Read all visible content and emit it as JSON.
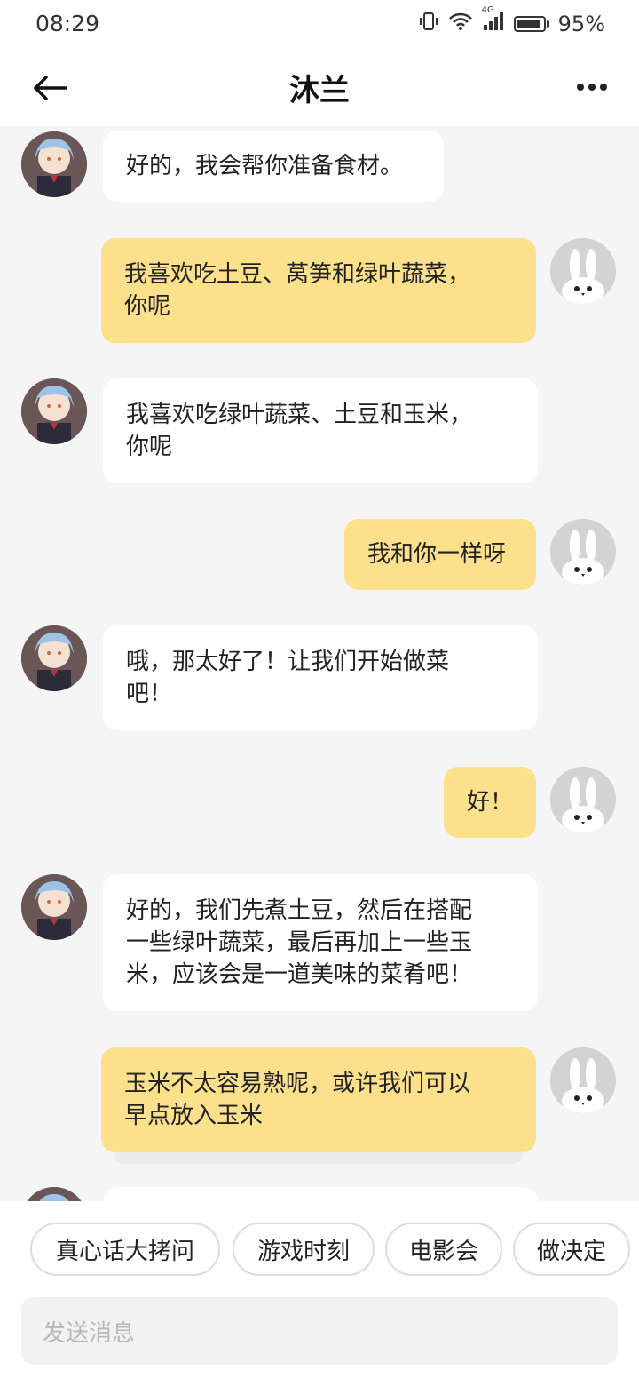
{
  "status_bar": {
    "time": "08:29",
    "network": "4G",
    "battery_percent": "95%",
    "icons": [
      "vibrate-icon",
      "wifi-icon",
      "signal-icon",
      "battery-icon"
    ]
  },
  "header": {
    "title": "沐兰",
    "back_icon": "back-arrow-icon",
    "more_icon": "more-icon"
  },
  "messages": [
    {
      "sender": "bot",
      "lines": [
        "好的，我会帮你准备食材。"
      ]
    },
    {
      "sender": "user",
      "lines": [
        "我喜欢吃土豆、莴笋和绿叶蔬菜，",
        "你呢"
      ]
    },
    {
      "sender": "bot",
      "lines": [
        "我喜欢吃绿叶蔬菜、土豆和玉米，",
        "你呢"
      ]
    },
    {
      "sender": "user",
      "lines": [
        "我和你一样呀"
      ]
    },
    {
      "sender": "bot",
      "lines": [
        "哦，那太好了！让我们开始做菜",
        "吧！"
      ]
    },
    {
      "sender": "user",
      "lines": [
        "好！"
      ]
    },
    {
      "sender": "bot",
      "lines": [
        "好的，我们先煮土豆，然后在搭配",
        "一些绿叶蔬菜，最后再加上一些玉",
        "米，应该会是一道美味的菜肴吧！"
      ]
    },
    {
      "sender": "user",
      "lines": [
        "玉米不太容易熟呢，或许我们可以",
        "早点放入玉米"
      ]
    }
  ],
  "suggestions": [
    "真心话大拷问",
    "游戏时刻",
    "电影会",
    "做决定"
  ],
  "input": {
    "placeholder": "发送消息"
  },
  "colors": {
    "user_bubble": "#fde08b",
    "bot_bubble": "#ffffff",
    "background": "#f5f5f5"
  }
}
